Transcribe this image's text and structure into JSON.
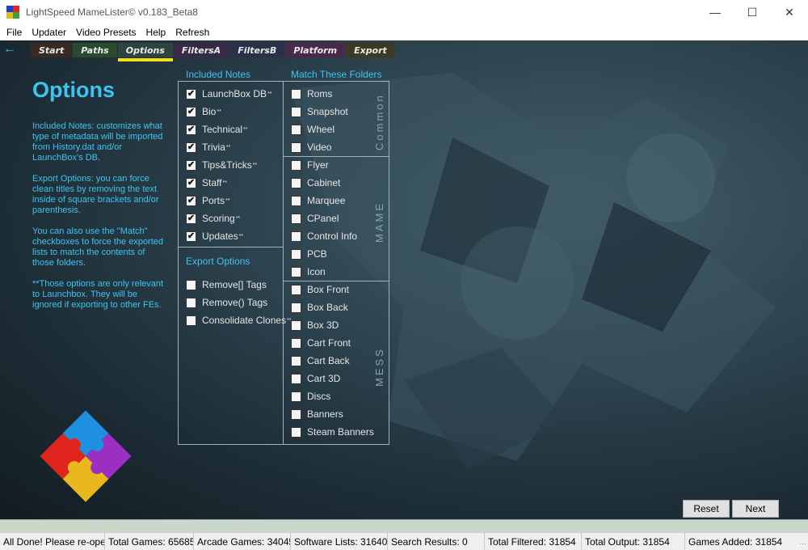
{
  "window": {
    "title": "LightSpeed MameLister© v0.183_Beta8"
  },
  "menu": [
    "File",
    "Updater",
    "Video Presets",
    "Help",
    "Refresh"
  ],
  "nav": {
    "back_icon": "back-arrow-icon",
    "tabs": [
      "Start",
      "Paths",
      "Options",
      "FiltersA",
      "FiltersB",
      "Platform",
      "Export"
    ],
    "active": "Options"
  },
  "page": {
    "title": "Options",
    "help": [
      "Included Notes: customizes what type of metadata will be imported from History.dat and/or LaunchBox's DB.",
      "Export Options: you can force clean titles by removing the text inside of square brackets and/or parenthesis.",
      "You can also use the \"Match\" checkboxes to force the exported lists to match the contents of those folders.",
      "**Those options are only relevant to Launchbox. They will be ignored if exporting to other FEs."
    ]
  },
  "included_notes": {
    "label": "Included Notes",
    "items": [
      {
        "label": "LaunchBox DB",
        "sup": "**",
        "checked": true
      },
      {
        "label": "Bio",
        "sup": "**",
        "checked": true
      },
      {
        "label": "Technical",
        "sup": "**",
        "checked": true
      },
      {
        "label": "Trivia",
        "sup": "**",
        "checked": true
      },
      {
        "label": "Tips&Tricks",
        "sup": "**",
        "checked": true
      },
      {
        "label": "Staff",
        "sup": "**",
        "checked": true
      },
      {
        "label": "Ports",
        "sup": "**",
        "checked": true
      },
      {
        "label": "Scoring",
        "sup": "**",
        "checked": true
      },
      {
        "label": "Updates",
        "sup": "**",
        "checked": true
      }
    ]
  },
  "export_options": {
    "label": "Export Options",
    "items": [
      {
        "label": "Remove[] Tags",
        "sup": "",
        "checked": false
      },
      {
        "label": "Remove() Tags",
        "sup": "",
        "checked": false
      },
      {
        "label": "Consolidate Clones",
        "sup": "**",
        "checked": false
      }
    ]
  },
  "match_folders": {
    "label": "Match These Folders",
    "groups": [
      {
        "name": "Common",
        "items": [
          "Roms",
          "Snapshot",
          "Wheel",
          "Video"
        ]
      },
      {
        "name": "MAME",
        "items": [
          "Flyer",
          "Cabinet",
          "Marquee",
          "CPanel",
          "Control Info",
          "PCB",
          "Icon"
        ]
      },
      {
        "name": "MESS",
        "items": [
          "Box Front",
          "Box Back",
          "Box 3D",
          "Cart Front",
          "Cart Back",
          "Cart 3D",
          "Discs",
          "Banners",
          "Steam Banners"
        ]
      }
    ]
  },
  "buttons": {
    "reset": "Reset",
    "next": "Next"
  },
  "status": [
    "All Done! Please re-open La",
    "Total Games: 65685",
    "Arcade Games: 34045",
    "Software Lists: 31640",
    "Search Results: 0",
    "Total Filtered: 31854",
    "Total Output: 31854",
    "Games Added: 31854"
  ],
  "colors": {
    "accent": "#3ec4f0",
    "active_tab": "#f1e01a"
  }
}
